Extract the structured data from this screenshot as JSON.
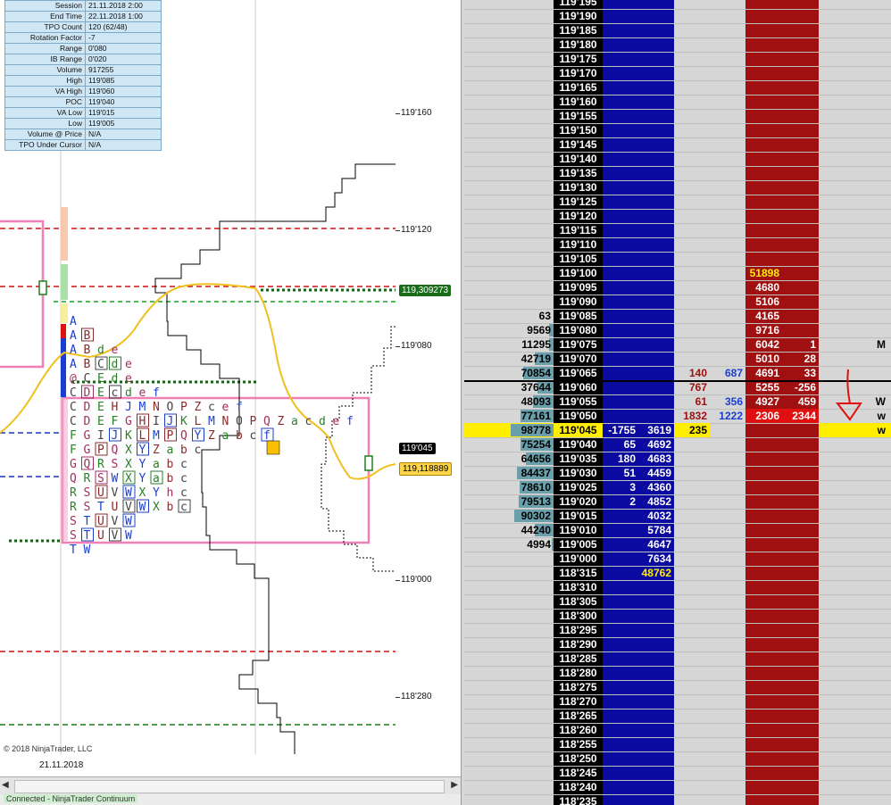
{
  "info_panel": [
    {
      "label": "Session",
      "value": "21.11.2018 2:00"
    },
    {
      "label": "End Time",
      "value": "22.11.2018 1:00"
    },
    {
      "label": "TPO Count",
      "value": "120 (62/48)"
    },
    {
      "label": "Rotation Factor",
      "value": "-7"
    },
    {
      "label": "Range",
      "value": "0'080"
    },
    {
      "label": "IB Range",
      "value": "0'020"
    },
    {
      "label": "Volume",
      "value": "917255"
    },
    {
      "label": "High",
      "value": "119'085"
    },
    {
      "label": "VA High",
      "value": "119'060"
    },
    {
      "label": "POC",
      "value": "119'040"
    },
    {
      "label": "VA Low",
      "value": "119'015"
    },
    {
      "label": "Low",
      "value": "119'005"
    },
    {
      "label": "Volume @ Price",
      "value": "N/A"
    },
    {
      "label": "TPO Under Cursor",
      "value": "N/A"
    }
  ],
  "price_axis": {
    "labels": [
      "119'160",
      "119'120",
      "119'080",
      "119'000",
      "118'280"
    ],
    "flags": [
      {
        "text": "119,309273",
        "bg": "#1a6b1a",
        "fg": "#ffffff"
      },
      {
        "text": "119'045",
        "bg": "#000000",
        "fg": "#ffffff"
      },
      {
        "text": "119,118889",
        "bg": "#ffd54a",
        "fg": "#000000"
      }
    ]
  },
  "tpo_rows": [
    "A",
    "AB",
    "ABde",
    "ABCde",
    "@CEde",
    "CDEcdef",
    "CDEHJMNOPZcef",
    "CDEFGHIJKLMNOPQZacdef",
    "FGIJKLMPQYZabcf",
    "FGPQXYZabc",
    "GQRSXYabc",
    "QRSWXYabc",
    "RSUVWXYhc",
    "RSTUVWXbc",
    "STUVW",
    "STUVW",
    "TW"
  ],
  "tpo_colors": {
    "A": "#1a3fd0",
    "B": "#8b2a2a",
    "C": "#444444",
    "D": "#a03060",
    "E": "#2a7f2a",
    "F": "#2a7f2a",
    "G": "#a03060",
    "H": "#8b2a2a",
    "I": "#444444",
    "J": "#1a3fd0",
    "K": "#2a7f2a",
    "L": "#8b2a2a",
    "M": "#1a3fd0",
    "N": "#8b2a2a",
    "O": "#444444",
    "P": "#8b2a2a",
    "Q": "#a03060",
    "R": "#2a7f2a",
    "S": "#a03060",
    "T": "#1a3fd0",
    "U": "#8b2a2a",
    "V": "#444444",
    "W": "#1a3fd0",
    "X": "#2a7f2a",
    "Y": "#1a3fd0",
    "Z": "#8b2a2a",
    "a": "#2a7f2a",
    "b": "#8b2a2a",
    "c": "#444444",
    "d": "#2a7f2a",
    "e": "#a03060",
    "f": "#1a3fd0",
    "h": "#a03060",
    "@": "#a03060"
  },
  "chart_footer": {
    "copyright": "© 2018 NinjaTrader, LLC",
    "date": "21.11.2018"
  },
  "status": {
    "text": "Connected - NinjaTrader Continuum"
  },
  "ladder": {
    "colors": {
      "bid_col": "#0a0aa0",
      "ask_col": "#a01010",
      "price_bg": "#000000",
      "price_fg": "#ffffff",
      "teal": "#6aa0ac",
      "highlight": "#ffee00"
    },
    "rows": [
      {
        "price": "119'195"
      },
      {
        "price": "119'190"
      },
      {
        "price": "119'185"
      },
      {
        "price": "119'180"
      },
      {
        "price": "119'175"
      },
      {
        "price": "119'170"
      },
      {
        "price": "119'165"
      },
      {
        "price": "119'160"
      },
      {
        "price": "119'155"
      },
      {
        "price": "119'150"
      },
      {
        "price": "119'145"
      },
      {
        "price": "119'140"
      },
      {
        "price": "119'135"
      },
      {
        "price": "119'130"
      },
      {
        "price": "119'125"
      },
      {
        "price": "119'120"
      },
      {
        "price": "119'115"
      },
      {
        "price": "119'110"
      },
      {
        "price": "119'105"
      },
      {
        "price": "119'100",
        "ask": "51898",
        "ask_hl": true
      },
      {
        "price": "119'095",
        "ask": "4680"
      },
      {
        "price": "119'090",
        "ask": "5106"
      },
      {
        "price": "119'085",
        "vol": "63",
        "ask": "4165"
      },
      {
        "price": "119'080",
        "vol": "9569",
        "ask": "9716"
      },
      {
        "price": "119'075",
        "vol": "11295",
        "ask": "6042",
        "asz": "1",
        "marker": "M"
      },
      {
        "price": "119'070",
        "vol": "42719",
        "ask": "5010",
        "asz": "28"
      },
      {
        "price": "119'065",
        "vol": "70854",
        "ask": "4691",
        "asz": "33",
        "bsz": "140",
        "bsz2": "687"
      },
      {
        "price": "119'060",
        "vol": "37644",
        "ask": "5255",
        "asz": "-256",
        "bsz": "767"
      },
      {
        "price": "119'055",
        "vol": "48093",
        "ask": "4927",
        "asz": "459",
        "bsz": "61",
        "bsz2": "356",
        "marker": "W"
      },
      {
        "price": "119'050",
        "vol": "77161",
        "ask": "2306",
        "asz": "2344",
        "bsz": "1832",
        "bsz2": "1222",
        "marker": "w",
        "askred": true
      },
      {
        "price": "119'045",
        "vol": "98778",
        "bid": "-1755",
        "bid2": "3619",
        "bsz": "235",
        "marker": "w",
        "current": true
      },
      {
        "price": "119'040",
        "vol": "75254",
        "bid": "65",
        "bid2": "4692"
      },
      {
        "price": "119'035",
        "vol": "64656",
        "bid": "180",
        "bid2": "4683"
      },
      {
        "price": "119'030",
        "vol": "84437",
        "bid": "51",
        "bid2": "4459"
      },
      {
        "price": "119'025",
        "vol": "78610",
        "bid": "3",
        "bid2": "4360"
      },
      {
        "price": "119'020",
        "vol": "79513",
        "bid": "2",
        "bid2": "4852"
      },
      {
        "price": "119'015",
        "vol": "90302",
        "bid2": "4032"
      },
      {
        "price": "119'010",
        "vol": "44240",
        "bid2": "5784"
      },
      {
        "price": "119'005",
        "vol": "4994",
        "bid2": "4647"
      },
      {
        "price": "119'000",
        "bid2": "7634"
      },
      {
        "price": "118'315",
        "bid2": "48762",
        "bid_hl": true
      },
      {
        "price": "118'310"
      },
      {
        "price": "118'305"
      },
      {
        "price": "118'300"
      },
      {
        "price": "118'295"
      },
      {
        "price": "118'290"
      },
      {
        "price": "118'285"
      },
      {
        "price": "118'280"
      },
      {
        "price": "118'275"
      },
      {
        "price": "118'270"
      },
      {
        "price": "118'265"
      },
      {
        "price": "118'260"
      },
      {
        "price": "118'255"
      },
      {
        "price": "118'250"
      },
      {
        "price": "118'245"
      },
      {
        "price": "118'240"
      },
      {
        "price": "118'235"
      }
    ]
  }
}
